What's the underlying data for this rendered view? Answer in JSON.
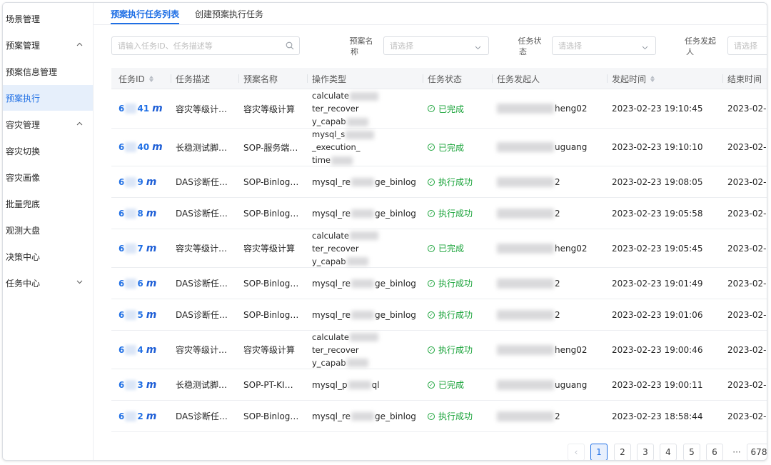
{
  "sidebar": {
    "items": [
      {
        "label": "场景管理",
        "chevron": ""
      },
      {
        "label": "预案管理",
        "chevron": "up"
      },
      {
        "label": "预案信息管理",
        "chevron": ""
      },
      {
        "label": "预案执行",
        "chevron": "",
        "active": true
      },
      {
        "label": "容灾管理",
        "chevron": "up"
      },
      {
        "label": "容灾切换",
        "chevron": ""
      },
      {
        "label": "容灾画像",
        "chevron": ""
      },
      {
        "label": "批量兜底",
        "chevron": ""
      },
      {
        "label": "观测大盘",
        "chevron": ""
      },
      {
        "label": "决策中心",
        "chevron": ""
      },
      {
        "label": "任务中心",
        "chevron": "down"
      }
    ]
  },
  "tabs": [
    {
      "label": "预案执行任务列表",
      "active": true
    },
    {
      "label": "创建预案执行任务",
      "active": false
    }
  ],
  "filters": {
    "search_placeholder": "请输入任务ID、任务描述等",
    "plan_name_label_1": "预案名",
    "plan_name_label_2": "称",
    "plan_name_placeholder": "请选择",
    "status_label_1": "任务状",
    "status_label_2": "态",
    "status_placeholder": "请选择",
    "initiator_label_1": "任务发起",
    "initiator_label_2": "人",
    "initiator_placeholder": "请选择"
  },
  "table": {
    "columns": [
      "任务ID",
      "任务描述",
      "预案名称",
      "操作类型",
      "任务状态",
      "任务发起人",
      "发起时间",
      "结束时间"
    ],
    "rows": [
      {
        "id_pre": "6",
        "id_post": "41",
        "desc": "容灾等级计…",
        "plan": "容灾等级计算",
        "op_a": "calculate",
        "op_b": "ter_recover",
        "op_c": "y_capab",
        "status": "已完成",
        "user_post": "heng02",
        "time": "2023-02-23 19:10:45",
        "end": "2023-02-"
      },
      {
        "id_pre": "6",
        "id_post": "40",
        "desc": "长稳测试脚…",
        "plan": "SOP-服务端…",
        "op_a": "mysql_s",
        "op_b": "_execution_",
        "op_c": "time",
        "status": "已完成",
        "user_post": "uguang",
        "time": "2023-02-23 19:10:10",
        "end": "2023-02-"
      },
      {
        "id_pre": "6",
        "id_post": "9",
        "desc": "DAS诊断任…",
        "plan": "SOP-Binlog…",
        "op_a": "mysql_re",
        "op_b": "ge_binlog",
        "op_c": "",
        "status": "执行成功",
        "user_post": "2",
        "time": "2023-02-23 19:08:05",
        "end": "2023-02-"
      },
      {
        "id_pre": "6",
        "id_post": "8",
        "desc": "DAS诊断任…",
        "plan": "SOP-Binlog…",
        "op_a": "mysql_re",
        "op_b": "ge_binlog",
        "op_c": "",
        "status": "执行成功",
        "user_post": "2",
        "time": "2023-02-23 19:05:58",
        "end": "2023-02-"
      },
      {
        "id_pre": "6",
        "id_post": "7",
        "desc": "容灾等级计…",
        "plan": "容灾等级计算",
        "op_a": "calculate",
        "op_b": "ter_recover",
        "op_c": "y_capab",
        "status": "已完成",
        "user_post": "heng02",
        "time": "2023-02-23 19:05:45",
        "end": "2023-02-"
      },
      {
        "id_pre": "6",
        "id_post": "6",
        "desc": "DAS诊断任…",
        "plan": "SOP-Binlog…",
        "op_a": "mysql_re",
        "op_b": "ge_binlog",
        "op_c": "",
        "status": "执行成功",
        "user_post": "2",
        "time": "2023-02-23 19:01:49",
        "end": "2023-02-"
      },
      {
        "id_pre": "6",
        "id_post": "5",
        "desc": "DAS诊断任…",
        "plan": "SOP-Binlog…",
        "op_a": "mysql_re",
        "op_b": "ge_binlog",
        "op_c": "",
        "status": "执行成功",
        "user_post": "2",
        "time": "2023-02-23 19:01:06",
        "end": "2023-02-"
      },
      {
        "id_pre": "6",
        "id_post": "4",
        "desc": "容灾等级计…",
        "plan": "容灾等级计算",
        "op_a": "calculate",
        "op_b": "ter_recover",
        "op_c": "y_capab",
        "status": "执行成功",
        "user_post": "heng02",
        "time": "2023-02-23 19:00:46",
        "end": "2023-02-"
      },
      {
        "id_pre": "6",
        "id_post": "3",
        "desc": "长稳测试脚…",
        "plan": "SOP-PT-KI…",
        "op_a": "mysql_p",
        "op_b": "ql",
        "op_c": "",
        "status": "已完成",
        "user_post": "uguang",
        "time": "2023-02-23 19:00:11",
        "end": "2023-02-"
      },
      {
        "id_pre": "6",
        "id_post": "2",
        "desc": "DAS诊断任…",
        "plan": "SOP-Binlog…",
        "op_a": "mysql_re",
        "op_b": "ge_binlog",
        "op_c": "",
        "status": "执行成功",
        "user_post": "2",
        "time": "2023-02-23 18:58:44",
        "end": "2023-02-"
      }
    ]
  },
  "pagination": {
    "prev": "‹",
    "pages": [
      "1",
      "2",
      "3",
      "4",
      "5",
      "6"
    ],
    "ellipsis": "···",
    "last": "678",
    "current": "1"
  },
  "colors": {
    "accent": "#1f6fe5",
    "success": "#1aa33a",
    "active_bg": "#e6effb"
  }
}
